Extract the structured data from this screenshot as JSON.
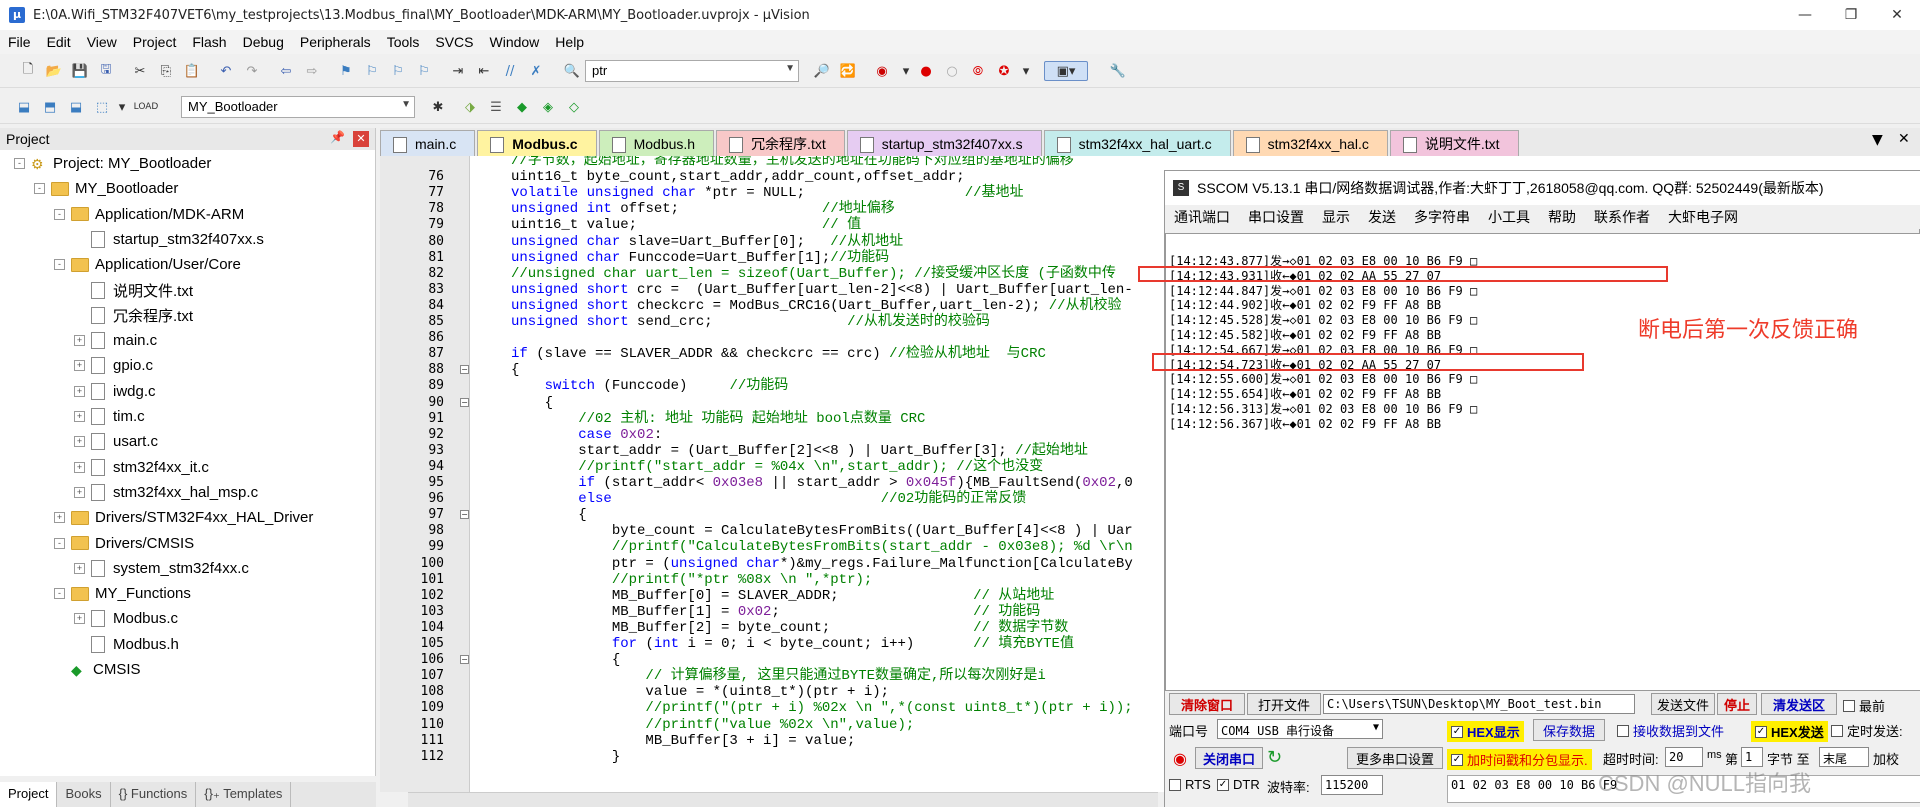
{
  "window": {
    "title": "E:\\0A.Wifi_STM32F407VET6\\my_testprojects\\13.Modbus_final\\MY_Bootloader\\MDK-ARM\\MY_Bootloader.uvprojx - µVision"
  },
  "menu": [
    "File",
    "Edit",
    "View",
    "Project",
    "Flash",
    "Debug",
    "Peripherals",
    "Tools",
    "SVCS",
    "Window",
    "Help"
  ],
  "toolbar": {
    "find_text": "ptr",
    "target": "MY_Bootloader"
  },
  "project": {
    "title": "Project",
    "tree": [
      {
        "label": "Project: MY_Bootloader",
        "level": 0,
        "kind": "root",
        "exp": "-"
      },
      {
        "label": "MY_Bootloader",
        "level": 1,
        "kind": "folder",
        "exp": "-"
      },
      {
        "label": "Application/MDK-ARM",
        "level": 2,
        "kind": "folder",
        "exp": "-"
      },
      {
        "label": "startup_stm32f407xx.s",
        "level": 3,
        "kind": "file",
        "exp": ""
      },
      {
        "label": "Application/User/Core",
        "level": 2,
        "kind": "folder",
        "exp": "-"
      },
      {
        "label": "说明文件.txt",
        "level": 3,
        "kind": "file",
        "exp": ""
      },
      {
        "label": "冗余程序.txt",
        "level": 3,
        "kind": "file",
        "exp": ""
      },
      {
        "label": "main.c",
        "level": 3,
        "kind": "file",
        "exp": "+"
      },
      {
        "label": "gpio.c",
        "level": 3,
        "kind": "file",
        "exp": "+"
      },
      {
        "label": "iwdg.c",
        "level": 3,
        "kind": "file",
        "exp": "+"
      },
      {
        "label": "tim.c",
        "level": 3,
        "kind": "file",
        "exp": "+"
      },
      {
        "label": "usart.c",
        "level": 3,
        "kind": "file",
        "exp": "+"
      },
      {
        "label": "stm32f4xx_it.c",
        "level": 3,
        "kind": "file",
        "exp": "+"
      },
      {
        "label": "stm32f4xx_hal_msp.c",
        "level": 3,
        "kind": "file",
        "exp": "+"
      },
      {
        "label": "Drivers/STM32F4xx_HAL_Driver",
        "level": 2,
        "kind": "folder",
        "exp": "+"
      },
      {
        "label": "Drivers/CMSIS",
        "level": 2,
        "kind": "folder",
        "exp": "-"
      },
      {
        "label": "system_stm32f4xx.c",
        "level": 3,
        "kind": "file",
        "exp": "+"
      },
      {
        "label": "MY_Functions",
        "level": 2,
        "kind": "folder",
        "exp": "-"
      },
      {
        "label": "Modbus.c",
        "level": 3,
        "kind": "file",
        "exp": "+"
      },
      {
        "label": "Modbus.h",
        "level": 3,
        "kind": "file",
        "exp": ""
      },
      {
        "label": "CMSIS",
        "level": 2,
        "kind": "diamond",
        "exp": ""
      }
    ],
    "bottom_tabs": [
      "Project",
      "Books",
      "{} Functions",
      "{}₊ Templates"
    ]
  },
  "tabs": [
    {
      "label": "main.c",
      "color": "#d8e4f4",
      "active": false
    },
    {
      "label": "Modbus.c",
      "color": "#fff3a0",
      "active": true
    },
    {
      "label": "Modbus.h",
      "color": "#cdeebc",
      "active": false
    },
    {
      "label": "冗余程序.txt",
      "color": "#f8c8c8",
      "active": false
    },
    {
      "label": "startup_stm32f407xx.s",
      "color": "#e6ccf2",
      "active": false
    },
    {
      "label": "stm32f4xx_hal_uart.c",
      "color": "#c4ecec",
      "active": false
    },
    {
      "label": "stm32f4xx_hal.c",
      "color": "#ffd9b3",
      "active": false
    },
    {
      "label": "说明文件.txt",
      "color": "#f2c4dc",
      "active": false
    }
  ],
  "code_lines": [
    {
      "n": "",
      "t": "//字节数，起始地址，寄存器地址数量，主机发送的地址在功能码下对应组的基地址的偏移"
    },
    {
      "n": "76",
      "t": "uint16_t byte_count,start_addr,addr_count,offset_addr;"
    },
    {
      "n": "77",
      "t": "volatile unsigned char *ptr = NULL;                   //基地址"
    },
    {
      "n": "78",
      "t": "unsigned int offset;                 //地址偏移"
    },
    {
      "n": "79",
      "t": "uint16_t value;                      // 值"
    },
    {
      "n": "80",
      "t": "unsigned char slave=Uart_Buffer[0];   //从机地址"
    },
    {
      "n": "81",
      "t": "unsigned char Funccode=Uart_Buffer[1];//功能码"
    },
    {
      "n": "82",
      "t": "//unsigned char uart_len = sizeof(Uart_Buffer); //接受缓冲区长度 (子函数中传"
    },
    {
      "n": "83",
      "t": "unsigned short crc =  (Uart_Buffer[uart_len-2]<<8) | Uart_Buffer[uart_len-"
    },
    {
      "n": "84",
      "t": "unsigned short checkcrc = ModBus_CRC16(Uart_Buffer,uart_len-2); //从机校验"
    },
    {
      "n": "85",
      "t": "unsigned short send_crc;                //从机发送时的校验码"
    },
    {
      "n": "86",
      "t": ""
    },
    {
      "n": "87",
      "t": "if (slave == SLAVER_ADDR && checkcrc == crc) //检验从机地址  与CRC"
    },
    {
      "n": "88",
      "t": "{"
    },
    {
      "n": "89",
      "t": "    switch (Funccode)     //功能码"
    },
    {
      "n": "90",
      "t": "    {"
    },
    {
      "n": "91",
      "t": "        //02 主机: 地址 功能码 起始地址 bool点数量 CRC"
    },
    {
      "n": "92",
      "t": "        case 0x02:"
    },
    {
      "n": "93",
      "t": "        start_addr = (Uart_Buffer[2]<<8 ) | Uart_Buffer[3]; //起始地址"
    },
    {
      "n": "94",
      "t": "        //printf(\"start_addr = %04x \\n\",start_addr); //这个也没变"
    },
    {
      "n": "95",
      "t": "        if (start_addr< 0x03e8 || start_addr > 0x045f){MB_FaultSend(0x02,0"
    },
    {
      "n": "96",
      "t": "        else                                //02功能码的正常反馈"
    },
    {
      "n": "97",
      "t": "        {"
    },
    {
      "n": "98",
      "t": "            byte_count = CalculateBytesFromBits((Uart_Buffer[4]<<8 ) | Uar"
    },
    {
      "n": "99",
      "t": "            //printf(\"CalculateBytesFromBits(start_addr - 0x03e8); %d \\r\\n"
    },
    {
      "n": "100",
      "t": "            ptr = (unsigned char*)&my_regs.Failure_Malfunction[CalculateBy"
    },
    {
      "n": "101",
      "t": "            //printf(\"*ptr %08x \\n \",*ptr);"
    },
    {
      "n": "102",
      "t": "            MB_Buffer[0] = SLAVER_ADDR;                // 从站地址"
    },
    {
      "n": "103",
      "t": "            MB_Buffer[1] = 0x02;                       // 功能码"
    },
    {
      "n": "104",
      "t": "            MB_Buffer[2] = byte_count;                 // 数据字节数"
    },
    {
      "n": "105",
      "t": "            for (int i = 0; i < byte_count; i++)       // 填充BYTE值"
    },
    {
      "n": "106",
      "t": "            {"
    },
    {
      "n": "107",
      "t": "                // 计算偏移量, 这里只能通过BYTE数量确定,所以每次刚好是i"
    },
    {
      "n": "108",
      "t": "                value = *(uint8_t*)(ptr + i);"
    },
    {
      "n": "109",
      "t": "                //printf(\"(ptr + i) %02x \\n \",*(const uint8_t*)(ptr + i));"
    },
    {
      "n": "110",
      "t": "                //printf(\"value %02x \\n\",value);"
    },
    {
      "n": "111",
      "t": "                MB_Buffer[3 + i] = value;"
    },
    {
      "n": "112",
      "t": "            }"
    }
  ],
  "sscom": {
    "title": "SSCOM V5.13.1 串口/网络数据调试器,作者:大虾丁丁,2618058@qq.com. QQ群: 52502449(最新版本)",
    "menu": [
      "通讯端口",
      "串口设置",
      "显示",
      "发送",
      "多字符串",
      "小工具",
      "帮助",
      "联系作者",
      "大虾电子网"
    ],
    "log": [
      "[14:12:43.877]发→◇01 02 03 E8 00 10 B6 F9 □",
      "[14:12:43.931]收←◆01 02 02 AA 55 27 07",
      "[14:12:44.847]发→◇01 02 03 E8 00 10 B6 F9 □",
      "[14:12:44.902]收←◆01 02 02 F9 FF A8 BB",
      "[14:12:45.528]发→◇01 02 03 E8 00 10 B6 F9 □",
      "[14:12:45.582]收←◆01 02 02 F9 FF A8 BB",
      "[14:12:54.667]发→◇01 02 03 E8 00 10 B6 F9 □",
      "[14:12:54.723]收←◆01 02 02 AA 55 27 07",
      "[14:12:55.600]发→◇01 02 03 E8 00 10 B6 F9 □",
      "[14:12:55.654]收←◆01 02 02 F9 FF A8 BB",
      "[14:12:56.313]发→◇01 02 03 E8 00 10 B6 F9 □",
      "[14:12:56.367]收←◆01 02 02 F9 FF A8 BB"
    ],
    "clear_btn": "清除窗口",
    "open_file_btn": "打开文件",
    "file_path": "C:\\Users\\TSUN\\Desktop\\MY_Boot_test.bin",
    "send_file_btn": "发送文件",
    "stop_btn": "停止",
    "clear_send_btn": "清发送区",
    "last_cb": "最前",
    "port_label": "端口号",
    "port_value": "COM4 USB 串行设备",
    "hex_display": "HEX显示",
    "save_data": "保存数据",
    "recv_to_file": "接收数据到文件",
    "hex_send": "HEX发送",
    "timed_send": "定时发送:",
    "close_port": "关闭串口",
    "more_settings": "更多串口设置",
    "timestamp": "加时间戳和分包显示.",
    "timeout_label": "超时时间:",
    "timeout_value": "20",
    "timeout_unit": "ms",
    "page_label": "第",
    "page_value": "1",
    "byte_label": "字节 至",
    "end_label": "末尾",
    "add_label": "加校",
    "rts": "RTS",
    "dtr": "DTR",
    "baud_label": "波特率:",
    "baud_value": "115200",
    "send_data": "01 02 03 E8 00 10 B6 F9"
  },
  "annotation": "断电后第一次反馈正确",
  "watermark": "CSDN @NULL指向我",
  "colors": {
    "keyword": "#0000ff",
    "comment": "#008000",
    "number": "#7d1e99",
    "annotation": "#ee3b2a"
  }
}
